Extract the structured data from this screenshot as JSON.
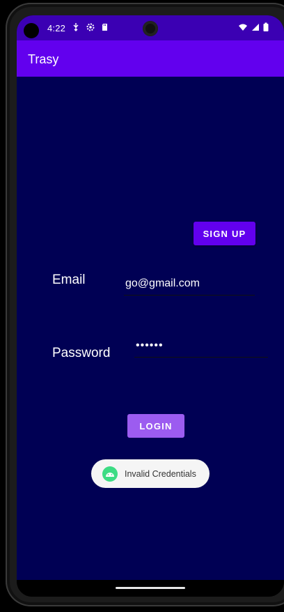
{
  "status_bar": {
    "time": "4:22",
    "left_icons": [
      "usb-debug-icon",
      "settings-gear-icon",
      "sd-card-icon"
    ],
    "right_icons": [
      "wifi-icon",
      "cell-signal-icon",
      "battery-icon"
    ]
  },
  "app_bar": {
    "title": "Trasy"
  },
  "form": {
    "signup_label": "SIGN UP",
    "email_label": "Email",
    "email_value": "go@gmail.com",
    "password_label": "Password",
    "password_value": "••••••",
    "login_label": "LOGIN"
  },
  "toast": {
    "message": "Invalid Credentials",
    "icon": "android-icon"
  },
  "colors": {
    "status_bar": "#3b00b3",
    "app_bar": "#6200ee",
    "background": "#000054",
    "signup_button": "#6200ee",
    "login_button": "#9c5cf0"
  }
}
